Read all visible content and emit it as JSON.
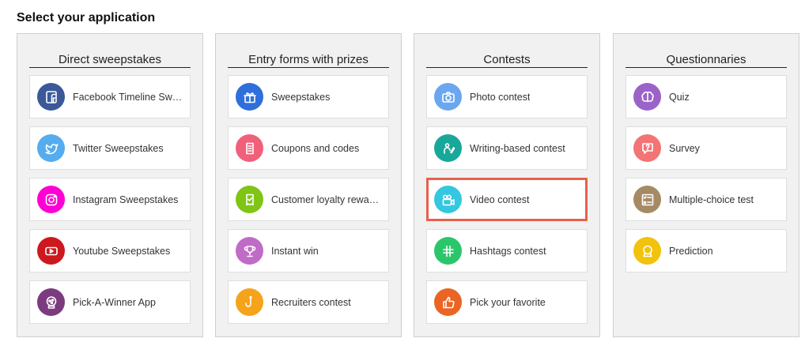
{
  "page_title": "Select your application",
  "columns": [
    {
      "title": "Direct sweepstakes",
      "items": [
        {
          "label": "Facebook Timeline Sweepstakes",
          "icon": "facebook-icon",
          "color": "#3b5998"
        },
        {
          "label": "Twitter Sweepstakes",
          "icon": "twitter-icon",
          "color": "#55acee"
        },
        {
          "label": "Instagram Sweepstakes",
          "icon": "instagram-icon",
          "color": "#ff00d4"
        },
        {
          "label": "Youtube Sweepstakes",
          "icon": "youtube-icon",
          "color": "#cc181e"
        },
        {
          "label": "Pick-A-Winner App",
          "icon": "lottery-machine-icon",
          "color": "#7b3b7e"
        }
      ]
    },
    {
      "title": "Entry forms with prizes",
      "items": [
        {
          "label": "Sweepstakes",
          "icon": "gift-icon",
          "color": "#2f6fdb"
        },
        {
          "label": "Coupons and codes",
          "icon": "coupon-icon",
          "color": "#f0607a"
        },
        {
          "label": "Customer loyalty rewards",
          "icon": "ticket-check-icon",
          "color": "#80c416"
        },
        {
          "label": "Instant win",
          "icon": "trophy-icon",
          "color": "#c06bc7"
        },
        {
          "label": "Recruiters contest",
          "icon": "hook-icon",
          "color": "#f5a31a"
        }
      ]
    },
    {
      "title": "Contests",
      "items": [
        {
          "label": "Photo contest",
          "icon": "camera-icon",
          "color": "#6ba7f0"
        },
        {
          "label": "Writing-based contest",
          "icon": "writer-icon",
          "color": "#17a89a"
        },
        {
          "label": "Video contest",
          "icon": "video-camera-icon",
          "color": "#33c7e0",
          "selected": true
        },
        {
          "label": "Hashtags contest",
          "icon": "hashtag-icon",
          "color": "#2bc66a"
        },
        {
          "label": "Pick your favorite",
          "icon": "thumbs-up-icon",
          "color": "#ea6423"
        }
      ]
    },
    {
      "title": "Questionnaries",
      "items": [
        {
          "label": "Quiz",
          "icon": "brain-icon",
          "color": "#9b63c9"
        },
        {
          "label": "Survey",
          "icon": "question-bubble-icon",
          "color": "#f27474"
        },
        {
          "label": "Multiple-choice test",
          "icon": "checklist-icon",
          "color": "#a68a64"
        },
        {
          "label": "Prediction",
          "icon": "crystal-ball-icon",
          "color": "#f2c20c"
        }
      ]
    }
  ]
}
